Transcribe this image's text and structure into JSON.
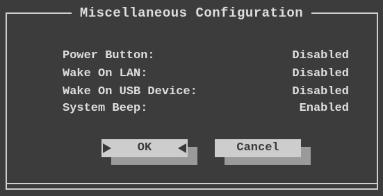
{
  "dialog": {
    "title": "Miscellaneous Configuration",
    "settings": [
      {
        "label": "Power Button:",
        "value": "Disabled"
      },
      {
        "label": "Wake On LAN:",
        "value": "Disabled"
      },
      {
        "label": "Wake On USB Device:",
        "value": "Disabled"
      },
      {
        "label": "System Beep:",
        "value": "Enabled"
      }
    ],
    "buttons": {
      "ok": "OK",
      "cancel": "Cancel"
    }
  }
}
